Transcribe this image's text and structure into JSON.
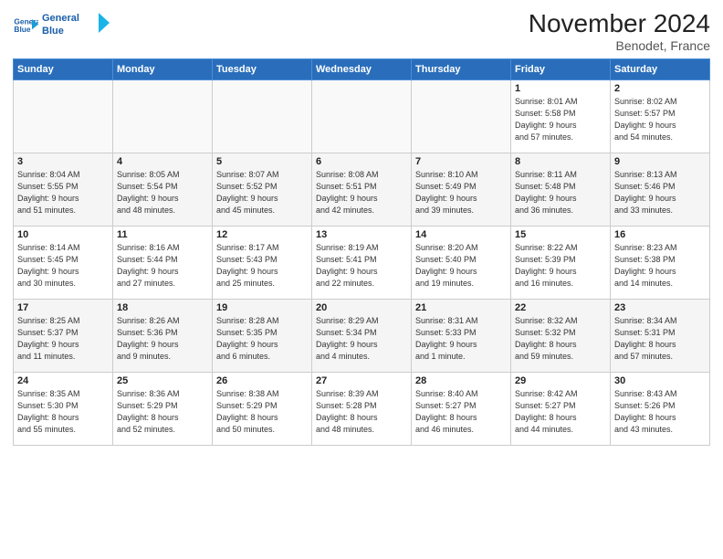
{
  "header": {
    "logo_line1": "General",
    "logo_line2": "Blue",
    "month": "November 2024",
    "location": "Benodet, France"
  },
  "days_of_week": [
    "Sunday",
    "Monday",
    "Tuesday",
    "Wednesday",
    "Thursday",
    "Friday",
    "Saturday"
  ],
  "weeks": [
    [
      {
        "day": "",
        "info": ""
      },
      {
        "day": "",
        "info": ""
      },
      {
        "day": "",
        "info": ""
      },
      {
        "day": "",
        "info": ""
      },
      {
        "day": "",
        "info": ""
      },
      {
        "day": "1",
        "info": "Sunrise: 8:01 AM\nSunset: 5:58 PM\nDaylight: 9 hours\nand 57 minutes."
      },
      {
        "day": "2",
        "info": "Sunrise: 8:02 AM\nSunset: 5:57 PM\nDaylight: 9 hours\nand 54 minutes."
      }
    ],
    [
      {
        "day": "3",
        "info": "Sunrise: 8:04 AM\nSunset: 5:55 PM\nDaylight: 9 hours\nand 51 minutes."
      },
      {
        "day": "4",
        "info": "Sunrise: 8:05 AM\nSunset: 5:54 PM\nDaylight: 9 hours\nand 48 minutes."
      },
      {
        "day": "5",
        "info": "Sunrise: 8:07 AM\nSunset: 5:52 PM\nDaylight: 9 hours\nand 45 minutes."
      },
      {
        "day": "6",
        "info": "Sunrise: 8:08 AM\nSunset: 5:51 PM\nDaylight: 9 hours\nand 42 minutes."
      },
      {
        "day": "7",
        "info": "Sunrise: 8:10 AM\nSunset: 5:49 PM\nDaylight: 9 hours\nand 39 minutes."
      },
      {
        "day": "8",
        "info": "Sunrise: 8:11 AM\nSunset: 5:48 PM\nDaylight: 9 hours\nand 36 minutes."
      },
      {
        "day": "9",
        "info": "Sunrise: 8:13 AM\nSunset: 5:46 PM\nDaylight: 9 hours\nand 33 minutes."
      }
    ],
    [
      {
        "day": "10",
        "info": "Sunrise: 8:14 AM\nSunset: 5:45 PM\nDaylight: 9 hours\nand 30 minutes."
      },
      {
        "day": "11",
        "info": "Sunrise: 8:16 AM\nSunset: 5:44 PM\nDaylight: 9 hours\nand 27 minutes."
      },
      {
        "day": "12",
        "info": "Sunrise: 8:17 AM\nSunset: 5:43 PM\nDaylight: 9 hours\nand 25 minutes."
      },
      {
        "day": "13",
        "info": "Sunrise: 8:19 AM\nSunset: 5:41 PM\nDaylight: 9 hours\nand 22 minutes."
      },
      {
        "day": "14",
        "info": "Sunrise: 8:20 AM\nSunset: 5:40 PM\nDaylight: 9 hours\nand 19 minutes."
      },
      {
        "day": "15",
        "info": "Sunrise: 8:22 AM\nSunset: 5:39 PM\nDaylight: 9 hours\nand 16 minutes."
      },
      {
        "day": "16",
        "info": "Sunrise: 8:23 AM\nSunset: 5:38 PM\nDaylight: 9 hours\nand 14 minutes."
      }
    ],
    [
      {
        "day": "17",
        "info": "Sunrise: 8:25 AM\nSunset: 5:37 PM\nDaylight: 9 hours\nand 11 minutes."
      },
      {
        "day": "18",
        "info": "Sunrise: 8:26 AM\nSunset: 5:36 PM\nDaylight: 9 hours\nand 9 minutes."
      },
      {
        "day": "19",
        "info": "Sunrise: 8:28 AM\nSunset: 5:35 PM\nDaylight: 9 hours\nand 6 minutes."
      },
      {
        "day": "20",
        "info": "Sunrise: 8:29 AM\nSunset: 5:34 PM\nDaylight: 9 hours\nand 4 minutes."
      },
      {
        "day": "21",
        "info": "Sunrise: 8:31 AM\nSunset: 5:33 PM\nDaylight: 9 hours\nand 1 minute."
      },
      {
        "day": "22",
        "info": "Sunrise: 8:32 AM\nSunset: 5:32 PM\nDaylight: 8 hours\nand 59 minutes."
      },
      {
        "day": "23",
        "info": "Sunrise: 8:34 AM\nSunset: 5:31 PM\nDaylight: 8 hours\nand 57 minutes."
      }
    ],
    [
      {
        "day": "24",
        "info": "Sunrise: 8:35 AM\nSunset: 5:30 PM\nDaylight: 8 hours\nand 55 minutes."
      },
      {
        "day": "25",
        "info": "Sunrise: 8:36 AM\nSunset: 5:29 PM\nDaylight: 8 hours\nand 52 minutes."
      },
      {
        "day": "26",
        "info": "Sunrise: 8:38 AM\nSunset: 5:29 PM\nDaylight: 8 hours\nand 50 minutes."
      },
      {
        "day": "27",
        "info": "Sunrise: 8:39 AM\nSunset: 5:28 PM\nDaylight: 8 hours\nand 48 minutes."
      },
      {
        "day": "28",
        "info": "Sunrise: 8:40 AM\nSunset: 5:27 PM\nDaylight: 8 hours\nand 46 minutes."
      },
      {
        "day": "29",
        "info": "Sunrise: 8:42 AM\nSunset: 5:27 PM\nDaylight: 8 hours\nand 44 minutes."
      },
      {
        "day": "30",
        "info": "Sunrise: 8:43 AM\nSunset: 5:26 PM\nDaylight: 8 hours\nand 43 minutes."
      }
    ]
  ]
}
